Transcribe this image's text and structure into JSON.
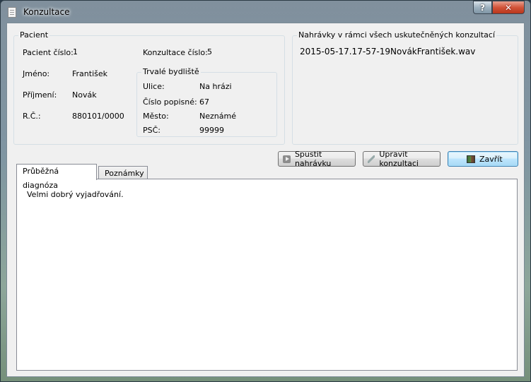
{
  "window": {
    "title": "Konzultace",
    "help_symbol": "?",
    "close_symbol": "✕",
    "icon": "document-icon"
  },
  "patient": {
    "group_title": "Pacient",
    "patient_number_label": "Pacient číslo:",
    "patient_number": "1",
    "consultation_number_label": "Konzultace číslo:",
    "consultation_number": "5",
    "first_name_label": "Jméno:",
    "first_name": "František",
    "last_name_label": "Příjmení:",
    "last_name": "Novák",
    "birth_number_label": "R.Č.:",
    "birth_number": "880101/0000",
    "address": {
      "group_title": "Trvalé bydliště",
      "street_label": "Ulice:",
      "street": "Na hrázi",
      "house_number_label": "Číslo popisné:",
      "house_number": "67",
      "city_label": "Město:",
      "city": "Neznámé",
      "zip_label": "PSČ:",
      "zip": "99999"
    }
  },
  "recordings": {
    "group_title": "Nahrávky v rámci  všech uskutečněných konzultací",
    "items": [
      "2015-05-17.17-57-19NovákFrantišek.wav"
    ]
  },
  "buttons": {
    "play_label": "Spustit nahrávku",
    "edit_label": "Upravit konzultaci",
    "close_label": "Zavřít"
  },
  "tabs": {
    "items": [
      {
        "label": "Průběžná diagnóza",
        "active": true
      },
      {
        "label": "Poznámky",
        "active": false
      }
    ],
    "content": "Velmi dobrý vyjadřování."
  }
}
